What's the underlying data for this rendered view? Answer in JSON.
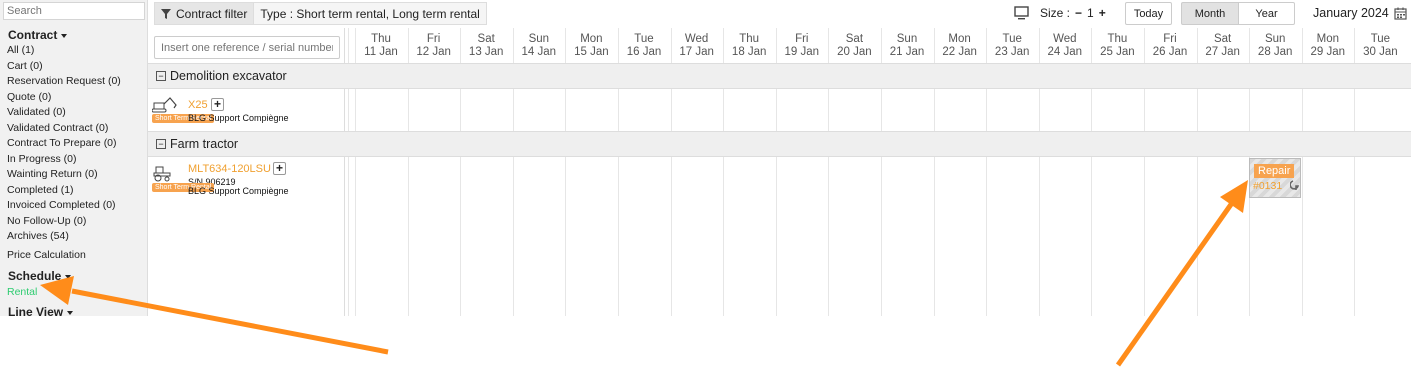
{
  "sidebar": {
    "search_placeholder": "Search",
    "contract_title": "Contract",
    "contract_items": [
      "All (1)",
      "Cart (0)",
      "Reservation Request (0)",
      "Quote (0)",
      "Validated (0)",
      "Validated Contract (0)",
      "Contract To Prepare (0)",
      "In Progress (0)",
      "Wainting Return (0)",
      "Completed (1)",
      "Invoiced Completed (0)",
      "No Follow-Up (0)",
      "Archives (54)"
    ],
    "price_calculation": "Price Calculation",
    "schedule_title": "Schedule",
    "rental_label": "Rental",
    "line_view_title": "Line View"
  },
  "toolbar": {
    "filter_label": "Contract filter",
    "filter_value": "Type : Short term rental, Long term rental",
    "size_label": "Size :",
    "size_minus": "−",
    "size_value": "1",
    "size_plus": "+",
    "today": "Today",
    "month": "Month",
    "year": "Year",
    "current_month": "January 2024"
  },
  "grid": {
    "reference_placeholder": "Insert one reference / serial number /",
    "days": [
      {
        "dow": "Thu",
        "date": "11 Jan"
      },
      {
        "dow": "Fri",
        "date": "12 Jan"
      },
      {
        "dow": "Sat",
        "date": "13 Jan"
      },
      {
        "dow": "Sun",
        "date": "14 Jan"
      },
      {
        "dow": "Mon",
        "date": "15 Jan"
      },
      {
        "dow": "Tue",
        "date": "16 Jan"
      },
      {
        "dow": "Wed",
        "date": "17 Jan"
      },
      {
        "dow": "Thu",
        "date": "18 Jan"
      },
      {
        "dow": "Fri",
        "date": "19 Jan"
      },
      {
        "dow": "Sat",
        "date": "20 Jan"
      },
      {
        "dow": "Sun",
        "date": "21 Jan"
      },
      {
        "dow": "Mon",
        "date": "22 Jan"
      },
      {
        "dow": "Tue",
        "date": "23 Jan"
      },
      {
        "dow": "Wed",
        "date": "24 Jan"
      },
      {
        "dow": "Thu",
        "date": "25 Jan"
      },
      {
        "dow": "Fri",
        "date": "26 Jan"
      },
      {
        "dow": "Sat",
        "date": "27 Jan"
      },
      {
        "dow": "Sun",
        "date": "28 Jan"
      },
      {
        "dow": "Mon",
        "date": "29 Jan"
      },
      {
        "dow": "Tue",
        "date": "30 Jan"
      }
    ],
    "groups": [
      {
        "name": "Demolition excavator",
        "item": {
          "name": "X25",
          "badge": "Short Term Rental",
          "serial": "",
          "location": "BLG Support Compiègne"
        }
      },
      {
        "name": "Farm tractor",
        "item": {
          "name": "MLT634-120LSU",
          "badge": "Short Term Rental",
          "serial": "S/N 906219",
          "location": "BLG Support Compiègne"
        }
      }
    ],
    "event": {
      "type": "Repair",
      "number": "#0131"
    }
  },
  "colors": {
    "accent": "#f7a34f",
    "active_link": "#2ecc71",
    "arrow": "#ff8c1a"
  }
}
